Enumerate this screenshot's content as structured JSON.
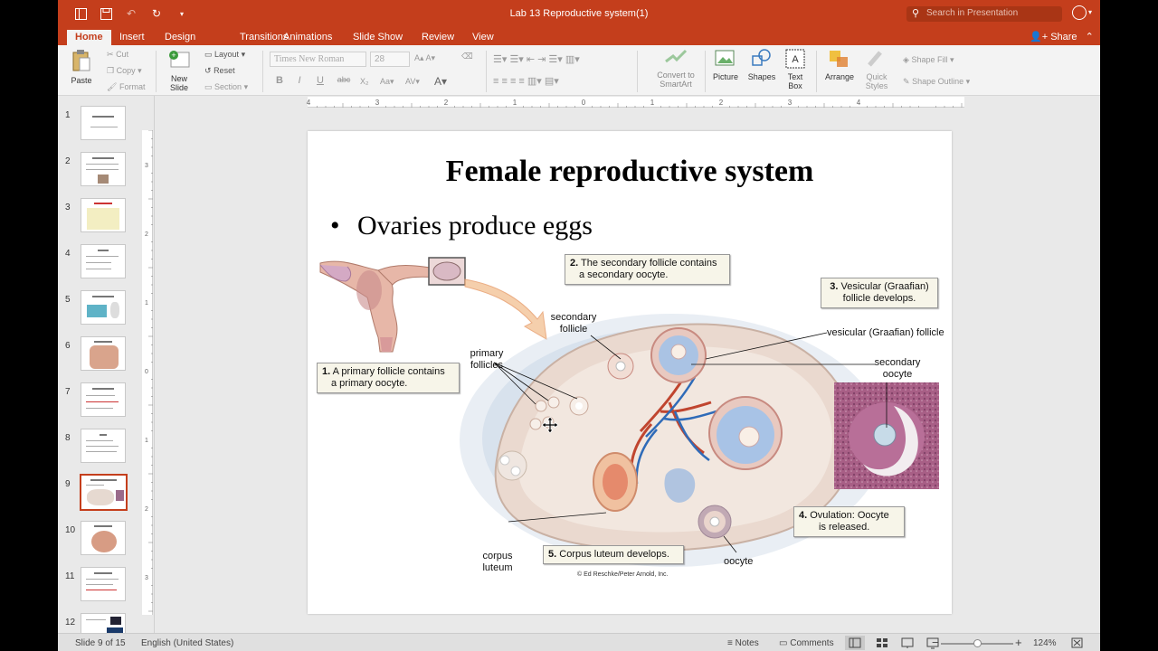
{
  "app": {
    "title": "Lab 13 Reproductive system(1)",
    "search_placeholder": "Search in Presentation",
    "share_label": "Share",
    "accent": "#c43e1c"
  },
  "tabs": [
    {
      "label": "Home",
      "active": true
    },
    {
      "label": "Insert"
    },
    {
      "label": "Design"
    },
    {
      "label": "Transitions"
    },
    {
      "label": "Animations"
    },
    {
      "label": "Slide Show"
    },
    {
      "label": "Review"
    },
    {
      "label": "View"
    }
  ],
  "ribbon": {
    "paste": "Paste",
    "cut": "Cut",
    "copy": "Copy",
    "format": "Format",
    "new_slide_1": "New",
    "new_slide_2": "Slide",
    "layout": "Layout",
    "reset": "Reset",
    "section": "Section",
    "font_name": "Times New Roman",
    "font_size": "28",
    "bold": "B",
    "italic": "I",
    "underline": "U",
    "strike": "abc",
    "convert_1": "Convert to",
    "convert_2": "SmartArt",
    "picture": "Picture",
    "shapes": "Shapes",
    "textbox_1": "Text",
    "textbox_2": "Box",
    "arrange": "Arrange",
    "quick_1": "Quick",
    "quick_2": "Styles",
    "shape_fill": "Shape Fill",
    "shape_outline": "Shape Outline"
  },
  "thumbnails": [
    "1",
    "2",
    "3",
    "4",
    "5",
    "6",
    "7",
    "8",
    "9",
    "10",
    "11",
    "12"
  ],
  "selected_slide": 9,
  "slide": {
    "title": "Female reproductive system",
    "bullet": "Ovaries produce eggs",
    "callouts": {
      "c1_num": "1.",
      "c1_text_a": "A primary follicle contains",
      "c1_text_b": "a primary oocyte.",
      "c2_num": "2.",
      "c2_text_a": "The secondary follicle contains",
      "c2_text_b": "a secondary oocyte.",
      "c3_num": "3.",
      "c3_text_a": "Vesicular (Graafian)",
      "c3_text_b": "follicle develops.",
      "c4_num": "4.",
      "c4_text_a": "Ovulation: Oocyte",
      "c4_text_b": "is released.",
      "c5_num": "5.",
      "c5_text": "Corpus luteum develops."
    },
    "labels": {
      "secondary_follicle_a": "secondary",
      "secondary_follicle_b": "follicle",
      "primary_follicles_a": "primary",
      "primary_follicles_b": "follicles",
      "vesicular": "vesicular (Graafian) follicle",
      "secondary_oocyte_a": "secondary",
      "secondary_oocyte_b": "oocyte",
      "corpus_a": "corpus",
      "corpus_b": "luteum",
      "oocyte": "oocyte",
      "credit": "© Ed Reschke/Peter Arnold, Inc."
    }
  },
  "statusbar": {
    "slide_info": "Slide 9 of 15",
    "language": "English (United States)",
    "notes": "Notes",
    "comments": "Comments",
    "zoom": "124%"
  }
}
